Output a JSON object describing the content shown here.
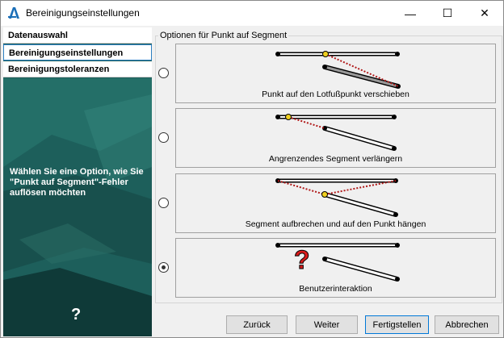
{
  "window": {
    "title": "Bereinigungseinstellungen"
  },
  "titlebar_controls": {
    "minimize": "—",
    "maximize": "☐",
    "close": "✕"
  },
  "sidebar": {
    "items": [
      {
        "label": "Datenauswahl",
        "selected": false
      },
      {
        "label": "Bereinigungseinstellungen",
        "selected": true
      },
      {
        "label": "Bereinigungstoleranzen",
        "selected": false
      }
    ],
    "description": "Wählen Sie eine Option, wie Sie \"Punkt auf Segment\"-Fehler auflösen möchten",
    "help": "?"
  },
  "options_group": {
    "label": "Optionen für Punkt auf Segment",
    "options": [
      {
        "caption": "Punkt auf den Lotfußpunkt verschieben",
        "checked": false,
        "icon": "move-point-to-perpendicular-diagram"
      },
      {
        "caption": "Angrenzendes Segment verlängern",
        "checked": false,
        "icon": "extend-adjacent-segment-diagram"
      },
      {
        "caption": "Segment aufbrechen und auf den Punkt hängen",
        "checked": false,
        "icon": "split-segment-snap-diagram"
      },
      {
        "caption": "Benutzerinteraktion",
        "checked": true,
        "icon": "user-interaction-question-diagram",
        "mark": "?"
      }
    ]
  },
  "buttons": {
    "back": "Zurück",
    "next": "Weiter",
    "finish": "Fertigstellen",
    "cancel": "Abbrechen"
  },
  "colors": {
    "sidebar": "#1d5f5b",
    "accent": "#2d7fc0",
    "dotted_line": "#b01818",
    "point": "#f0d020",
    "question": "#d81b1b"
  }
}
